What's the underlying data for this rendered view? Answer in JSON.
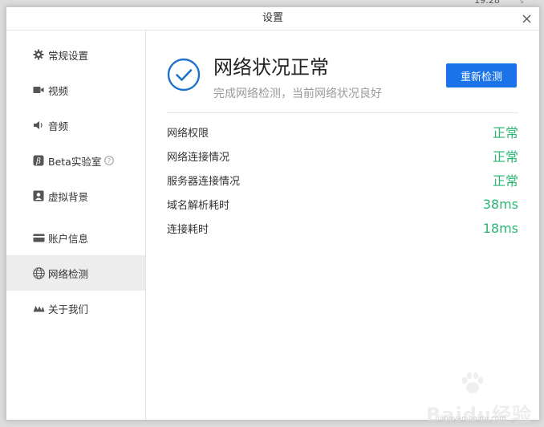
{
  "background": {
    "clock": "19:28"
  },
  "window": {
    "title": "设置"
  },
  "sidebar": {
    "items": [
      {
        "label": "常规设置",
        "icon": "gear-icon"
      },
      {
        "label": "视频",
        "icon": "camera-icon"
      },
      {
        "label": "音频",
        "icon": "speaker-icon"
      },
      {
        "label": "Beta实验室",
        "icon": "beta-icon"
      },
      {
        "label": "虚拟背景",
        "icon": "portrait-icon"
      },
      {
        "label": "账户信息",
        "icon": "card-icon"
      },
      {
        "label": "网络检测",
        "icon": "globe-icon",
        "active": true
      },
      {
        "label": "关于我们",
        "icon": "logo-icon"
      }
    ]
  },
  "main": {
    "status_title": "网络状况正常",
    "status_subtitle": "完成网络检测，当前网络状况良好",
    "recheck_label": "重新检测",
    "rows": [
      {
        "label": "网络权限",
        "value": "正常"
      },
      {
        "label": "网络连接情况",
        "value": "正常"
      },
      {
        "label": "服务器连接情况",
        "value": "正常"
      },
      {
        "label": "域名解析耗时",
        "value": "38ms"
      },
      {
        "label": "连接耗时",
        "value": "18ms"
      }
    ]
  },
  "watermark": {
    "text": "Baidu经验",
    "url": "jingyan.baidu.com"
  },
  "colors": {
    "accent": "#1a73e8",
    "ok": "#2bb673",
    "status_icon": "#1f72c9",
    "active_bg": "#ededed"
  }
}
